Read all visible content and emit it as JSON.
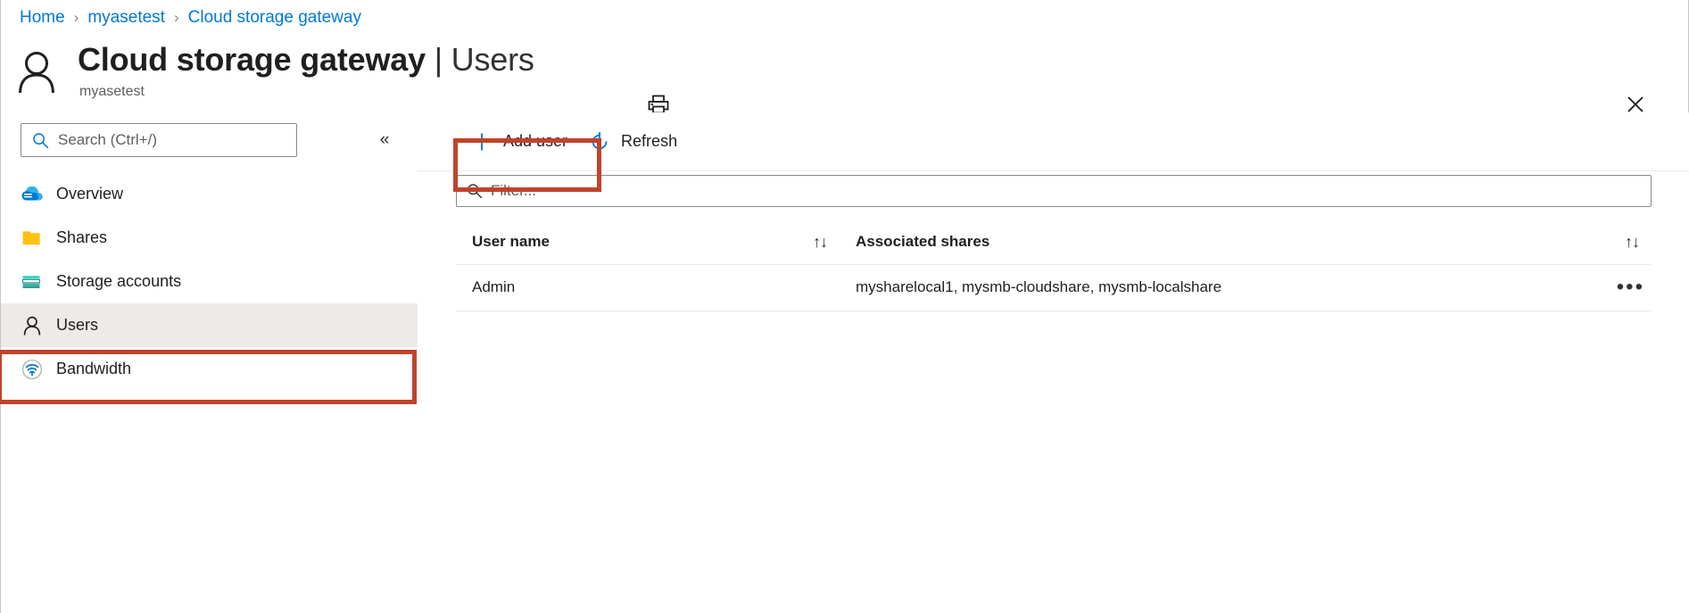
{
  "breadcrumb": {
    "separator": "›",
    "items": [
      {
        "label": "Home"
      },
      {
        "label": "myasetest"
      },
      {
        "label": "Cloud storage gateway"
      }
    ]
  },
  "header": {
    "resource_name": "Cloud storage gateway",
    "divider": "|",
    "section": "Users",
    "subtitle": "myasetest",
    "avatar_icon": "person-icon",
    "print_icon": "print-icon",
    "close_icon": "close-icon"
  },
  "sidebar": {
    "search": {
      "placeholder": "Search (Ctrl+/)",
      "value": "",
      "icon": "search-icon"
    },
    "collapse_icon": "«",
    "items": [
      {
        "label": "Overview",
        "icon": "cloud-icon",
        "selected": false
      },
      {
        "label": "Shares",
        "icon": "folder-icon",
        "selected": false
      },
      {
        "label": "Storage accounts",
        "icon": "storage-account-icon",
        "selected": false
      },
      {
        "label": "Users",
        "icon": "person-icon",
        "selected": true
      },
      {
        "label": "Bandwidth",
        "icon": "bandwidth-icon",
        "selected": false
      }
    ]
  },
  "toolbar": {
    "add_user_label": "Add user",
    "add_user_icon": "plus-icon",
    "refresh_label": "Refresh",
    "refresh_icon": "refresh-icon"
  },
  "filter": {
    "placeholder": "Filter...",
    "value": "",
    "icon": "search-icon"
  },
  "table": {
    "columns": [
      {
        "label": "User name",
        "sortable": true,
        "sort_icon": "↑↓"
      },
      {
        "label": "Associated shares",
        "sortable": true,
        "sort_icon": "↑↓"
      }
    ],
    "rows": [
      {
        "user_name": "Admin",
        "associated_shares": "mysharelocal1, mysmb-cloudshare, mysmb-localshare",
        "more_icon": "•••"
      }
    ]
  },
  "annotations": {
    "highlight_color": "#c0432a",
    "boxes": [
      {
        "target": "add-user-button"
      },
      {
        "target": "sidebar-item-users"
      }
    ]
  },
  "colors": {
    "link": "#0078d4",
    "accent": "#0078d4",
    "selected_bg": "#edebe9",
    "highlight": "#c0432a"
  }
}
